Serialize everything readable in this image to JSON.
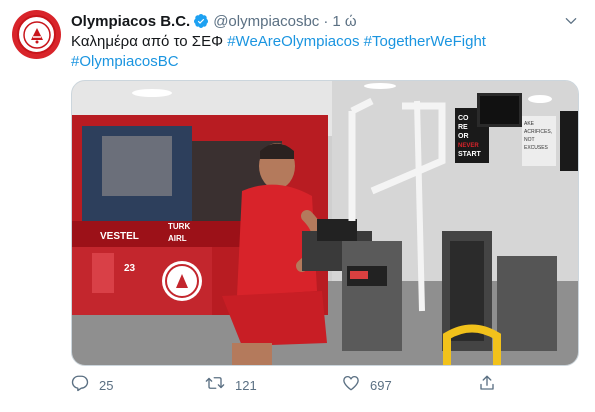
{
  "tweet": {
    "name": "Olympiacos B.C.",
    "handle": "@olympiacosbc",
    "separator": "·",
    "time": "1 ώ",
    "text": "Καλημέρα από το ΣΕΦ",
    "hashtags": [
      "#WeAreOlympiacos",
      "#TogetherWeFight",
      "#OlympiacosBC"
    ],
    "verified_icon": "verified-badge-icon",
    "avatar_icon": "olympiacos-logo-icon",
    "menu_icon": "chevron-down-icon"
  },
  "media": {
    "description_icon": "photo",
    "poster_text": [
      "CO",
      "RE",
      "OR",
      "NEVER",
      "START"
    ],
    "poster2_text": [
      "AKE",
      "ACRIFICES,",
      "NOT",
      "EXCUSES"
    ],
    "banner_text": [
      "VESTEL",
      "TURK",
      "AIRL"
    ],
    "jersey_number": "23"
  },
  "actions": {
    "reply": {
      "icon": "reply-icon",
      "count": "25"
    },
    "retweet": {
      "icon": "retweet-icon",
      "count": "121"
    },
    "like": {
      "icon": "heart-icon",
      "count": "697"
    },
    "share": {
      "icon": "share-icon"
    }
  },
  "colors": {
    "link": "#1b95e0",
    "muted": "#5b7083",
    "verified": "#1da1f2",
    "brand_red": "#d8242a"
  }
}
